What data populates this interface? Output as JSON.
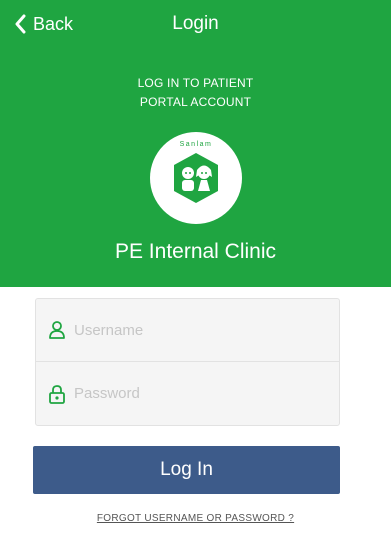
{
  "header": {
    "back_label": "Back",
    "title": "Login",
    "subtitle_line1": "LOG IN TO PATIENT",
    "subtitle_line2": "PORTAL ACCOUNT",
    "logo_text": "Sanlam",
    "clinic_name": "PE Internal Clinic"
  },
  "form": {
    "username_placeholder": "Username",
    "password_placeholder": "Password"
  },
  "actions": {
    "login_label": "Log In",
    "forgot_label": "FORGOT USERNAME OR PASSWORD ?"
  },
  "colors": {
    "header_bg": "#1fa541",
    "button_bg": "#3d5b8a",
    "icon_green": "#1fa541"
  },
  "icons": {
    "back": "chevron-left-icon",
    "logo": "kids-logo-icon",
    "user": "user-icon",
    "lock": "lock-icon"
  }
}
